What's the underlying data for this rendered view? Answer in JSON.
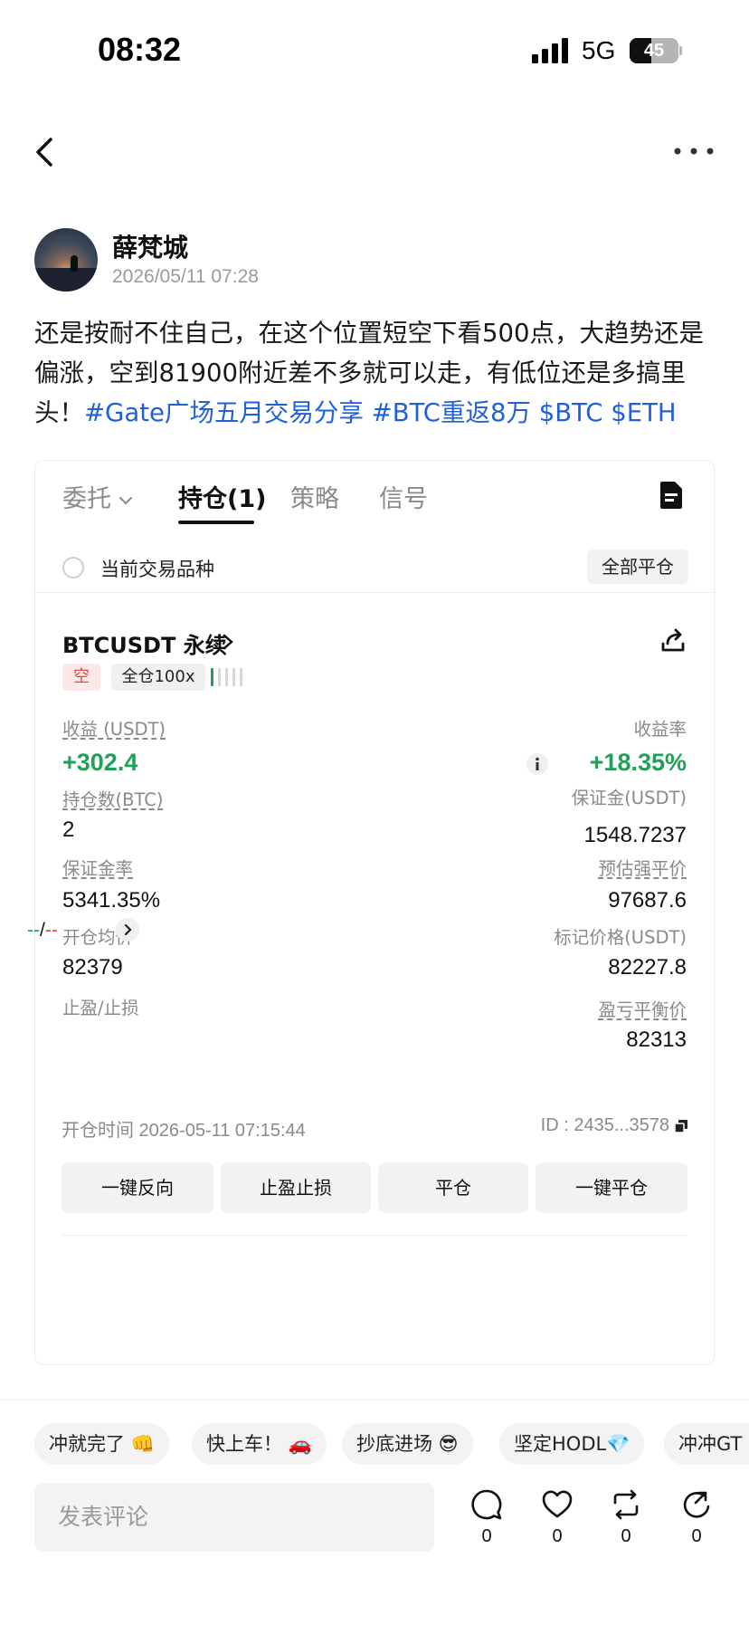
{
  "status_bar": {
    "time": "08:32",
    "network": "5G",
    "battery": "45",
    "battery_level": 0.45
  },
  "nav": {
    "back": "back-icon",
    "more": "more-icon"
  },
  "author": {
    "name": "薛梵城",
    "time": "2026/05/11 07:28"
  },
  "post": {
    "text": "还是按耐不住自己，在这个位置短空下看500点，大趋势还是偏涨，空到81900附近差不多就可以走，有低位还是多搞里头！",
    "tags": [
      "#Gate广场五月交易分享",
      "#BTC重返8万",
      "$BTC",
      "$ETH"
    ]
  },
  "card": {
    "tabs": [
      "委托",
      "持仓(1)",
      "策略",
      "信号"
    ],
    "filter_label": "当前交易品种",
    "close_all": "全部平仓",
    "pair": "BTCUSDT 永续",
    "side": "空",
    "leverage": "全仓100x",
    "pnl_label": "收益 (USDT)",
    "pnl": "+302.4",
    "roi_label": "收益率",
    "roi": "+18.35%",
    "size_label": "持仓数(BTC)",
    "size": "2",
    "margin_label": "保证金(USDT)",
    "margin": "1548.7237",
    "margin_ratio_label": "保证金率",
    "margin_ratio": "5341.35%",
    "liq_label": "预估强平价",
    "liq": "97687.6",
    "entry_label": "开仓均价",
    "entry": "82379",
    "mark_label": "标记价格(USDT)",
    "mark": "82227.8",
    "tpsl_label": "止盈/止损",
    "tp": "--",
    "sep": "/",
    "sl": "--",
    "breakeven_label": "盈亏平衡价",
    "breakeven": "82313",
    "open_time": "开仓时间 2026-05-11 07:15:44",
    "order_id": "ID : 2435...3578",
    "actions": [
      "一键反向",
      "止盈止损",
      "平仓",
      "一键平仓"
    ]
  },
  "quick_replies": [
    "冲就完了 👊",
    "快上车！ 🚗",
    "抄底进场 😎",
    "坚定HODL💎",
    "冲冲GT"
  ],
  "comment": {
    "placeholder": "发表评论"
  },
  "counts": {
    "comments": "0",
    "likes": "0",
    "reposts": "0",
    "shares": "0"
  },
  "colors": {
    "green": "#22a05a",
    "red": "#e04848",
    "link": "#2060d8"
  }
}
